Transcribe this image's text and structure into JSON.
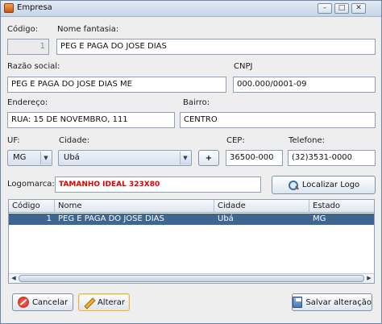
{
  "window": {
    "title": "Empresa",
    "controls": {
      "minimize": "–",
      "maximize": "□",
      "close": "✕"
    }
  },
  "form": {
    "codigo": {
      "label": "Código:",
      "value": "1"
    },
    "nome_fantasia": {
      "label": "Nome fantasia:",
      "value": "PEG E PAGA DO JOSE DIAS"
    },
    "razao_social": {
      "label": "Razão social:",
      "value": "PEG E PAGA DO JOSE DIAS ME"
    },
    "cnpj": {
      "label": "CNPJ",
      "value": "000.000/0001-09"
    },
    "endereco": {
      "label": "Endereço:",
      "value": "RUA: 15 DE NOVEMBRO, 111"
    },
    "bairro": {
      "label": "Bairro:",
      "value": "CENTRO"
    },
    "uf": {
      "label": "UF:",
      "value": "MG"
    },
    "cidade": {
      "label": "Cidade:",
      "value": "Ubá",
      "add_button": "+"
    },
    "cep": {
      "label": "CEP:",
      "value": "36500-000"
    },
    "telefone": {
      "label": "Telefone:",
      "value": "(32)3531-0000"
    },
    "logomarca": {
      "label": "Logomarca:",
      "value": "TAMANHO IDEAL 323X80",
      "color": "#e00000"
    },
    "localizar_logo": {
      "label": "Localizar Logo",
      "icon": "magnifier-icon"
    }
  },
  "table": {
    "columns": [
      "Código",
      "Nome",
      "Cidade",
      "Estado"
    ],
    "rows": [
      {
        "codigo": "1",
        "nome": "PEG E PAGA DO JOSE DIAS",
        "cidade": "Ubá",
        "estado": "MG"
      }
    ],
    "selected_row_color": "#3e6690"
  },
  "footer": {
    "cancelar": {
      "label": "Cancelar",
      "icon": "cancel-icon"
    },
    "alterar": {
      "label": "Alterar",
      "icon": "pencil-icon"
    },
    "salvar": {
      "label": "Salvar alteração",
      "icon": "floppy-disk-icon"
    }
  }
}
